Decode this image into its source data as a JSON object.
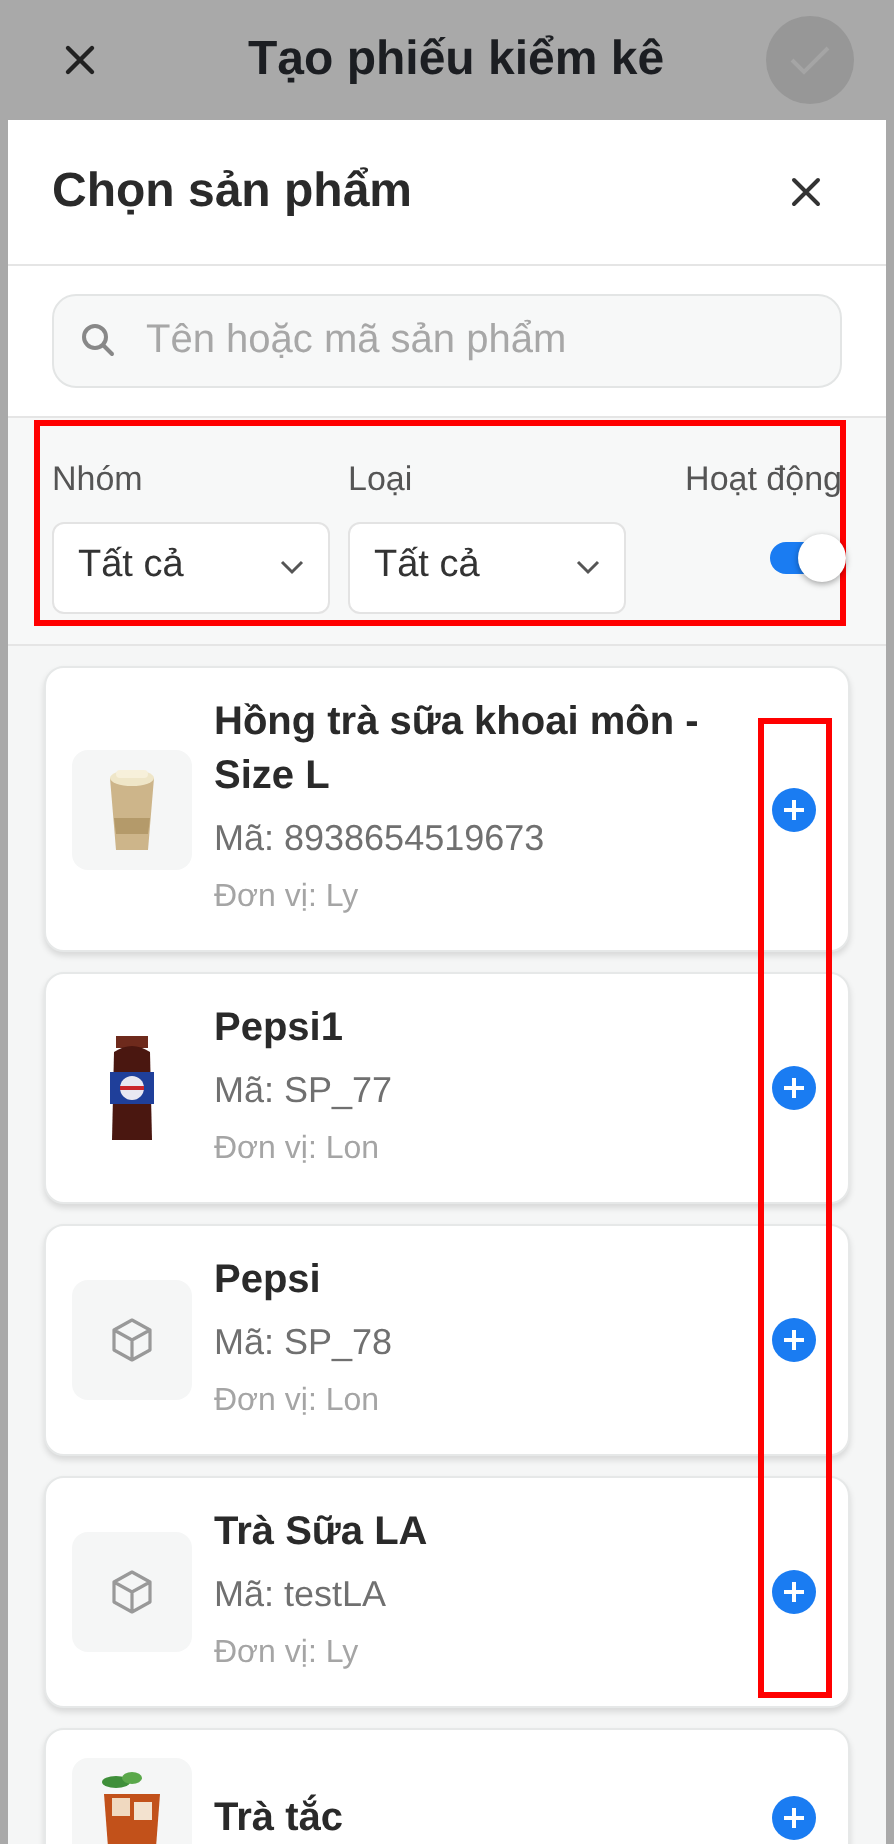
{
  "app_bar": {
    "title": "Tạo phiếu kiểm kê",
    "confirm_disabled": true
  },
  "sheet": {
    "title": "Chọn sản phẩm",
    "search": {
      "placeholder": "Tên hoặc mã sản phẩm"
    },
    "filters": {
      "highlighted": true,
      "group": {
        "label": "Nhóm",
        "value": "Tất cả"
      },
      "type": {
        "label": "Loại",
        "value": "Tất cả"
      },
      "active": {
        "label": "Hoạt động",
        "on": true
      }
    },
    "add_column_highlighted": true,
    "products": [
      {
        "name": "Hồng trà sữa khoai môn - Size L",
        "code": "Mã: 8938654519673",
        "unit": "Đơn vị: Ly",
        "kind": "picture"
      },
      {
        "name": "Pepsi1",
        "code": "Mã: SP_77",
        "unit": "Đơn vị: Lon",
        "kind": "picture"
      },
      {
        "name": "Pepsi",
        "code": "Mã: SP_78",
        "unit": "Đơn vị: Lon",
        "kind": "placeholder"
      },
      {
        "name": "Trà Sữa LA",
        "code": "Mã: testLA",
        "unit": "Đơn vị: Ly",
        "kind": "placeholder"
      },
      {
        "name": "Trà tắc",
        "kind": "picture"
      }
    ]
  }
}
